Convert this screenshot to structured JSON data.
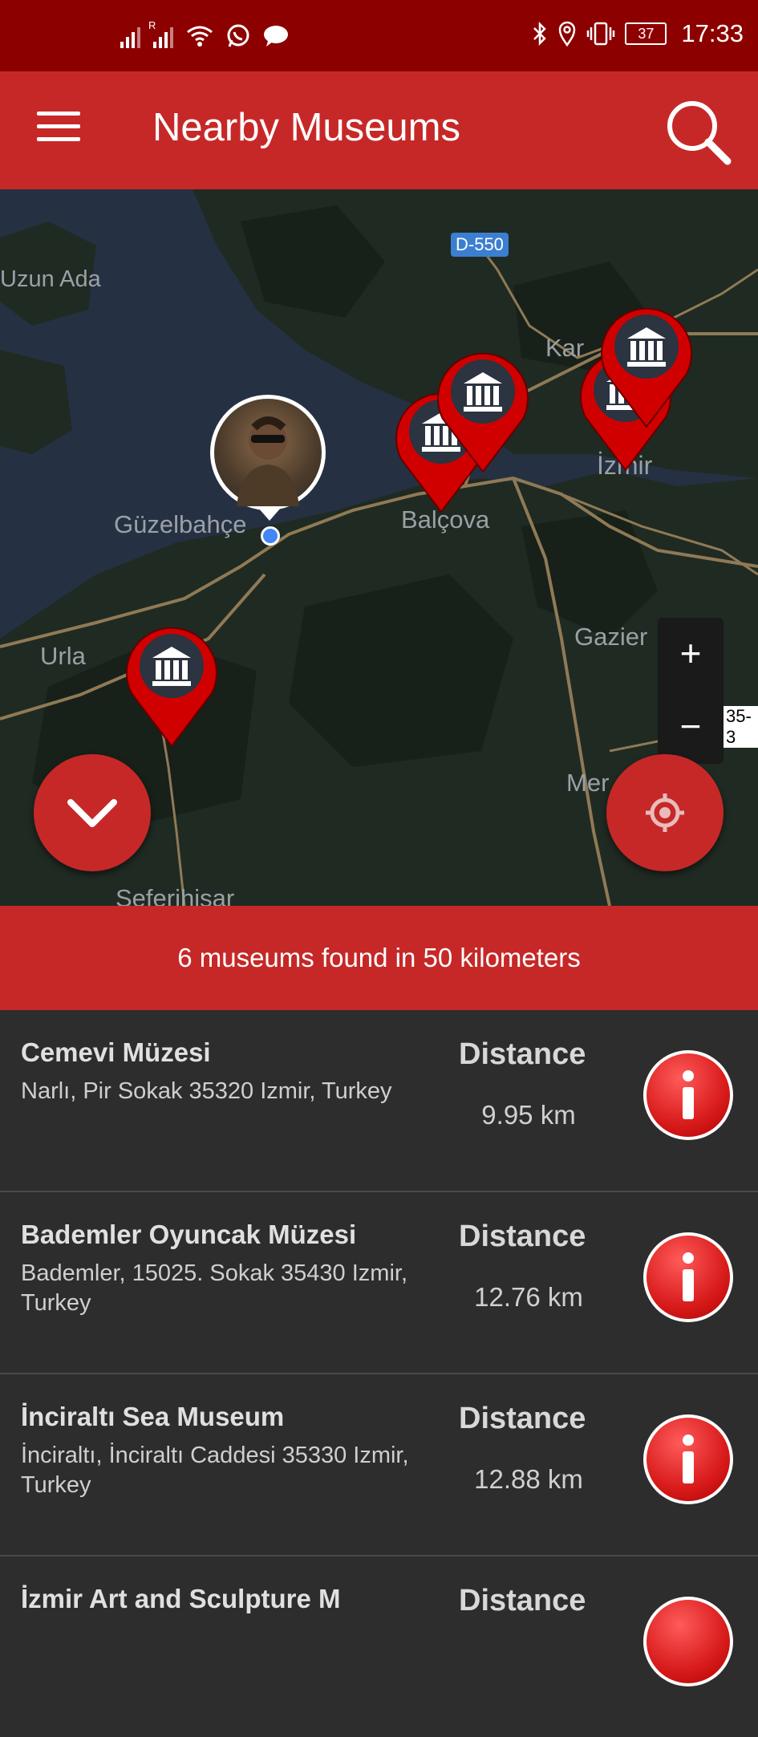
{
  "status_bar": {
    "time": "17:33",
    "battery": "37",
    "roaming_indicator": "R",
    "icons": [
      "signal-icon",
      "signal-roaming-icon",
      "wifi-icon",
      "whatsapp-icon",
      "message-icon",
      "bluetooth-icon",
      "location-icon",
      "vibrate-icon",
      "battery-icon"
    ]
  },
  "app_bar": {
    "title": "Nearby Museums",
    "menu_icon": "menu-icon",
    "search_icon": "search-icon"
  },
  "map": {
    "labels": {
      "uzun_ada": "Uzun Ada",
      "guzelbahce": "Güzelbahçe",
      "balcova": "Balçova",
      "izmir": "İzmir",
      "karsiyaka": "Kar",
      "urla": "Urla",
      "gaziemir": "Gazier",
      "menderes": "Mer",
      "seferihisar": "Seferihisar",
      "road_d550": "D-550",
      "road_o35": "35-3"
    },
    "zoom_in": "+",
    "zoom_out": "−",
    "pins": 6
  },
  "banner": {
    "text": "6 museums found in 50 kilometers"
  },
  "museums": [
    {
      "name": "Cemevi Müzesi",
      "address": "Narlı, Pir Sokak 35320 Izmir, Turkey",
      "distance_label": "Distance",
      "distance": "9.95 km"
    },
    {
      "name": "Bademler Oyuncak Müzesi",
      "address": "Bademler, 15025. Sokak 35430 Izmir, Turkey",
      "distance_label": "Distance",
      "distance": "12.76 km"
    },
    {
      "name": "İnciraltı Sea Museum",
      "address": "İnciraltı, İnciraltı Caddesi 35330 Izmir, Turkey",
      "distance_label": "Distance",
      "distance": "12.88 km"
    },
    {
      "name": "İzmir Art and Sculpture M",
      "address": "",
      "distance_label": "Distance",
      "distance": ""
    }
  ],
  "colors": {
    "status_bar": "#8c0000",
    "primary": "#c62828",
    "list_bg": "#2d2d2d",
    "map_water": "#253142",
    "map_land": "#1f2a22"
  }
}
